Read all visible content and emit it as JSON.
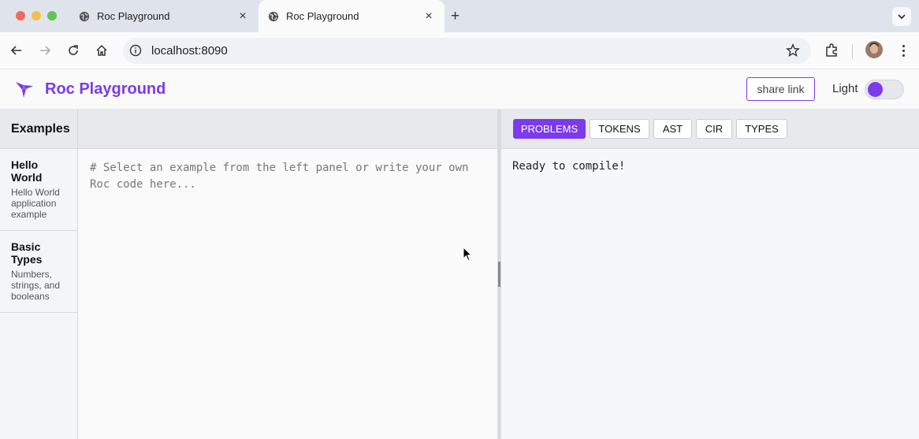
{
  "browser": {
    "tabs": [
      {
        "title": "Roc Playground",
        "active": false
      },
      {
        "title": "Roc Playground",
        "active": true
      }
    ],
    "new_tab": "+",
    "url": "localhost:8090"
  },
  "header": {
    "title": "Roc Playground",
    "share_label": "share link",
    "theme_label": "Light",
    "accent_color": "#7c3aed"
  },
  "sidebar": {
    "heading": "Examples",
    "items": [
      {
        "title": "Hello World",
        "description": "Hello World application example"
      },
      {
        "title": "Basic Types",
        "description": "Numbers, strings, and booleans"
      }
    ]
  },
  "editor": {
    "placeholder": "# Select an example from the left panel or write your own Roc code here..."
  },
  "output": {
    "tabs": [
      {
        "label": "PROBLEMS",
        "active": true
      },
      {
        "label": "TOKENS",
        "active": false
      },
      {
        "label": "AST",
        "active": false
      },
      {
        "label": "CIR",
        "active": false
      },
      {
        "label": "TYPES",
        "active": false
      }
    ],
    "message": "Ready to compile!"
  }
}
